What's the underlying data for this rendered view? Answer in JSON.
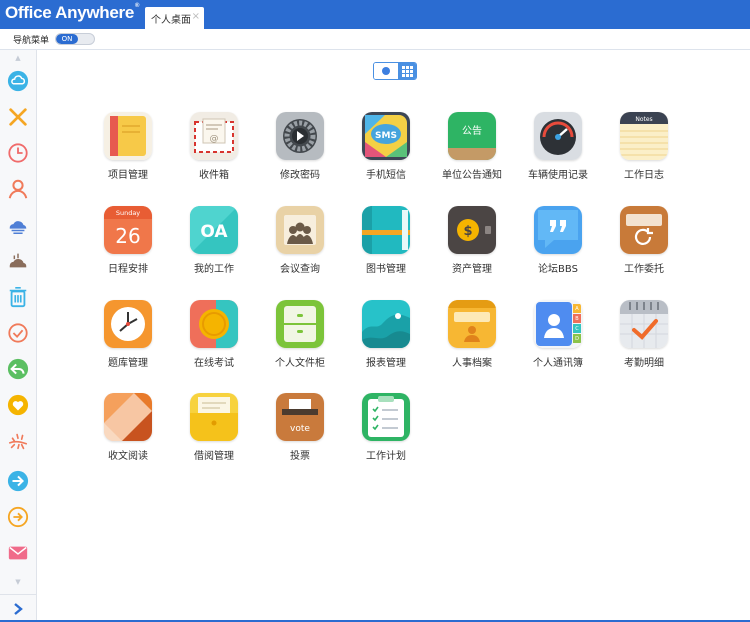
{
  "brand": {
    "logo_text": "Office Anywhere",
    "logo_mark": "®"
  },
  "tabs": [
    {
      "label": "个人桌面",
      "close": "×"
    }
  ],
  "nav": {
    "label": "导航菜单",
    "toggle_text": "ON"
  },
  "sidebar": {
    "scroll_up": "▲",
    "scroll_down": "▼",
    "items": [
      {
        "name": "cloud-icon",
        "color": "#3bb3e6"
      },
      {
        "name": "close-icon",
        "color": "#f5a623"
      },
      {
        "name": "clock-icon",
        "color": "#f06b6b"
      },
      {
        "name": "user-icon",
        "color": "#f07a5a"
      },
      {
        "name": "cloud-stack-icon",
        "color": "#4f7fd6"
      },
      {
        "name": "cloud-rain-icon",
        "color": "#8a6d5b"
      },
      {
        "name": "trash-icon",
        "color": "#3bb3e6"
      },
      {
        "name": "check-circle-icon",
        "color": "#f07a5a"
      },
      {
        "name": "reply-icon",
        "color": "#5bbf62"
      },
      {
        "name": "heart-icon",
        "color": "#f5b400"
      },
      {
        "name": "sparkle-icon",
        "color": "#f07a5a"
      },
      {
        "name": "arrow-right-circle-icon",
        "color": "#3bb3e6"
      },
      {
        "name": "arrow-right-outline-icon",
        "color": "#f5a623"
      },
      {
        "name": "mail-icon",
        "color": "#f06b8a"
      }
    ],
    "expand_icon": "chevron-right-icon"
  },
  "view_switch": {
    "left": "dot-icon",
    "right": "grid-icon"
  },
  "apps": [
    {
      "id": "project",
      "label": "项目管理",
      "icon": "notebook-icon"
    },
    {
      "id": "inbox",
      "label": "收件箱",
      "icon": "envelope-icon"
    },
    {
      "id": "password",
      "label": "修改密码",
      "icon": "gear-icon"
    },
    {
      "id": "sms",
      "label": "手机短信",
      "icon": "sms-icon",
      "icon_text": "SMS"
    },
    {
      "id": "notice",
      "label": "单位公告通知",
      "icon": "board-icon",
      "icon_text": "公告"
    },
    {
      "id": "vehicle",
      "label": "车辆使用记录",
      "icon": "speedometer-icon"
    },
    {
      "id": "worklog",
      "label": "工作日志",
      "icon": "notes-icon",
      "icon_text": "Notes"
    },
    {
      "id": "schedule",
      "label": "日程安排",
      "icon": "calendar-icon",
      "icon_text": "Sunday",
      "icon_num": "26"
    },
    {
      "id": "oa",
      "label": "我的工作",
      "icon": "oa-icon",
      "icon_text": "OA"
    },
    {
      "id": "meeting",
      "label": "会议查询",
      "icon": "meeting-icon"
    },
    {
      "id": "books",
      "label": "图书管理",
      "icon": "book-icon"
    },
    {
      "id": "assets",
      "label": "资产管理",
      "icon": "wallet-icon",
      "icon_text": "$"
    },
    {
      "id": "bbs",
      "label": "论坛BBS",
      "icon": "quote-icon"
    },
    {
      "id": "delegate",
      "label": "工作委托",
      "icon": "card-refresh-icon"
    },
    {
      "id": "questions",
      "label": "题库管理",
      "icon": "clock-icon"
    },
    {
      "id": "exam",
      "label": "在线考试",
      "icon": "coin-icon"
    },
    {
      "id": "files",
      "label": "个人文件柜",
      "icon": "cabinet-icon"
    },
    {
      "id": "reports",
      "label": "报表管理",
      "icon": "chart-icon"
    },
    {
      "id": "hr",
      "label": "人事档案",
      "icon": "person-folder-icon"
    },
    {
      "id": "contacts",
      "label": "个人通讯簿",
      "icon": "address-book-icon",
      "icon_tabs": [
        "A",
        "B",
        "C",
        "D"
      ]
    },
    {
      "id": "attendance",
      "label": "考勤明细",
      "icon": "calendar-check-icon"
    },
    {
      "id": "docs",
      "label": "收文阅读",
      "icon": "origami-icon"
    },
    {
      "id": "borrow",
      "label": "借阅管理",
      "icon": "folder-icon"
    },
    {
      "id": "vote",
      "label": "投票",
      "icon": "ballot-box-icon",
      "icon_text": "vote"
    },
    {
      "id": "plan",
      "label": "工作计划",
      "icon": "clipboard-icon"
    }
  ]
}
